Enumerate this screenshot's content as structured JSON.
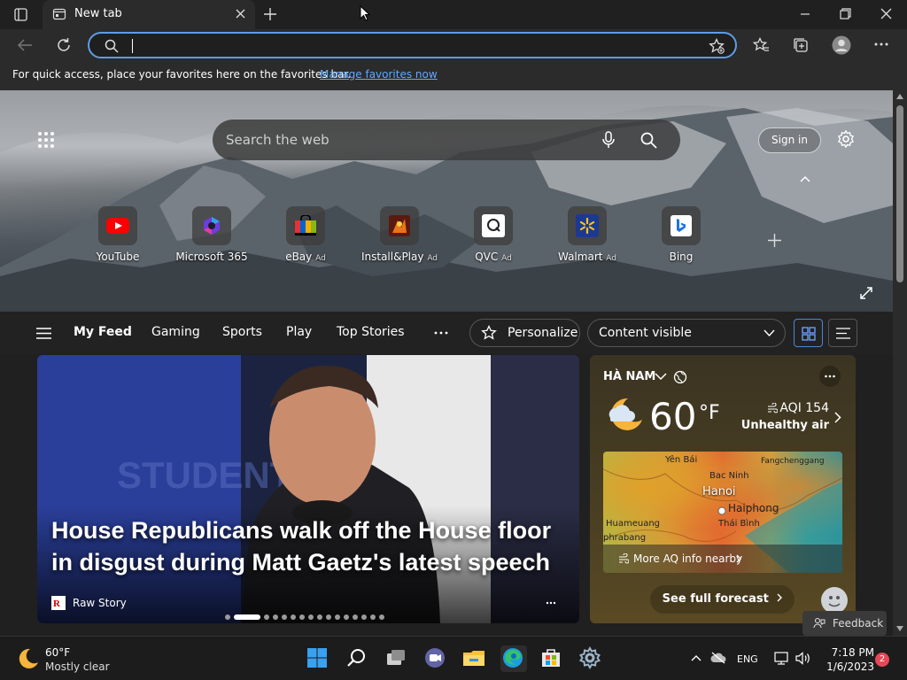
{
  "browser": {
    "tab_title": "New tab",
    "address_value": "",
    "favorites_message": "For quick access, place your favorites here on the favorites bar.",
    "favorites_link": "Manage favorites now"
  },
  "newtab": {
    "search_placeholder": "Search the web",
    "signin_label": "Sign in",
    "quick_links": [
      {
        "label": "YouTube",
        "ad": ""
      },
      {
        "label": "Microsoft 365",
        "ad": ""
      },
      {
        "label": "eBay",
        "ad": "Ad"
      },
      {
        "label": "Install&Play",
        "ad": "Ad"
      },
      {
        "label": "QVC",
        "ad": "Ad"
      },
      {
        "label": "Walmart",
        "ad": "Ad"
      },
      {
        "label": "Bing",
        "ad": ""
      }
    ]
  },
  "feed_nav": {
    "items": [
      "My Feed",
      "Gaming",
      "Sports",
      "Play",
      "Top Stories"
    ],
    "personalize_label": "Personalize",
    "content_visibility": "Content visible"
  },
  "main_story": {
    "headline": "House Republicans walk off the House floor in disgust during Matt Gaetz's latest speech",
    "source": "Raw Story",
    "carousel_count": 16,
    "carousel_active": 1
  },
  "weather": {
    "location": "HÀ NAM",
    "temperature": "60",
    "unit": "°F",
    "aqi": "AQI 154",
    "aqi_status": "Unhealthy air",
    "map_labels": {
      "yen_bai": "Yên Bái",
      "fangchenggang": "Fangchenggang",
      "bac_ninh": "Bac Ninh",
      "hanoi": "Hanoi",
      "haiphong": "Haiphong",
      "huameuang": "Huameuang",
      "thai_binh": "Thái Bình",
      "phrabang": "phrabang"
    },
    "more_aq": "More AQ info nearby",
    "forecast_label": "See full forecast"
  },
  "feedback_label": "Feedback",
  "taskbar": {
    "weather_temp": "60°F",
    "weather_desc": "Mostly clear",
    "language": "ENG",
    "time": "7:18 PM",
    "date": "1/6/2023",
    "notification_count": "2"
  }
}
